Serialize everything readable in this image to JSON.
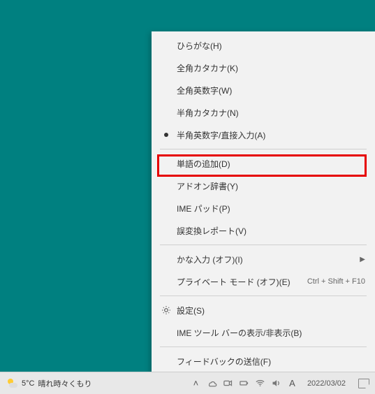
{
  "menu": {
    "items": [
      {
        "label": "ひらがな(H)"
      },
      {
        "label": "全角カタカナ(K)"
      },
      {
        "label": "全角英数字(W)"
      },
      {
        "label": "半角カタカナ(N)"
      },
      {
        "label": "半角英数字/直接入力(A)",
        "selected": true
      }
    ],
    "group2": [
      {
        "label": "単語の追加(D)",
        "highlighted": true
      },
      {
        "label": "アドオン辞書(Y)"
      },
      {
        "label": "IME パッド(P)"
      },
      {
        "label": "誤変換レポート(V)"
      }
    ],
    "group3": [
      {
        "label": "かな入力 (オフ)(I)",
        "submenu": true
      },
      {
        "label": "プライベート モード (オフ)(E)",
        "shortcut": "Ctrl + Shift + F10"
      }
    ],
    "group4": [
      {
        "label": "設定(S)",
        "icon": "gear"
      },
      {
        "label": "IME ツール バーの表示/非表示(B)"
      }
    ],
    "group5": [
      {
        "label": "フィードバックの送信(F)"
      }
    ]
  },
  "taskbar": {
    "temperature": "5°C",
    "weather_text": "晴れ時々くもり",
    "ime_indicator": "A",
    "date": "2022/03/02"
  }
}
